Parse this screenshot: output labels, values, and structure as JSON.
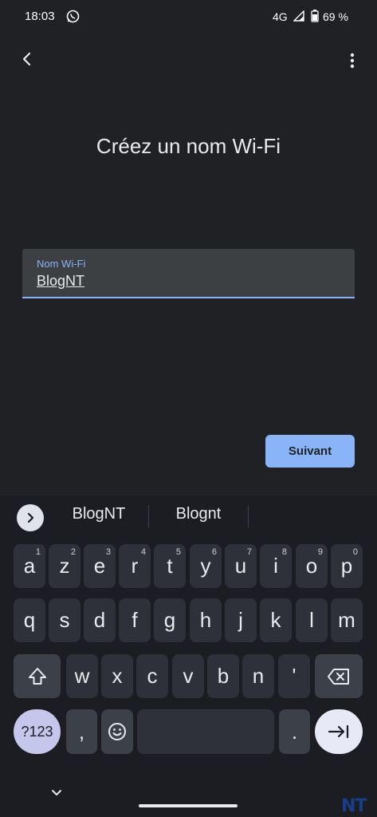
{
  "status": {
    "time": "18:03",
    "network": "4G",
    "battery": "69 %"
  },
  "icons": {
    "whatsapp": "whatsapp-icon",
    "signal": "signal-icon",
    "battery": "battery-icon",
    "back": "arrow-back-icon",
    "more": "more-vert-icon"
  },
  "page": {
    "title": "Créez un nom Wi-Fi"
  },
  "field": {
    "label": "Nom Wi-Fi",
    "value": "BlogNT"
  },
  "actions": {
    "next_label": "Suivant"
  },
  "keyboard": {
    "suggestions": [
      "BlogNT",
      "Blognt"
    ],
    "row1": [
      {
        "key": "a",
        "num": "1"
      },
      {
        "key": "z",
        "num": "2"
      },
      {
        "key": "e",
        "num": "3"
      },
      {
        "key": "r",
        "num": "4"
      },
      {
        "key": "t",
        "num": "5"
      },
      {
        "key": "y",
        "num": "6"
      },
      {
        "key": "u",
        "num": "7"
      },
      {
        "key": "i",
        "num": "8"
      },
      {
        "key": "o",
        "num": "9"
      },
      {
        "key": "p",
        "num": "0"
      }
    ],
    "row2": [
      "q",
      "s",
      "d",
      "f",
      "g",
      "h",
      "j",
      "k",
      "l",
      "m"
    ],
    "row3": [
      "w",
      "x",
      "c",
      "v",
      "b",
      "n",
      "'"
    ],
    "symbols_label": "?123",
    "comma": ",",
    "period": "."
  },
  "branding": {
    "logo_text": "NT"
  },
  "colors": {
    "background": "#202124",
    "accent": "#8ab4f8",
    "keyboard_bg": "#1b1d22",
    "key_bg": "#2e3139"
  }
}
